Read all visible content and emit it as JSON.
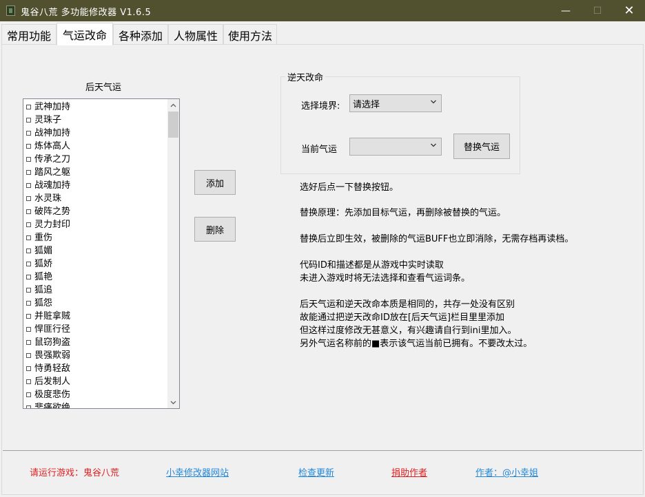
{
  "window": {
    "title": "鬼谷八荒 多功能修改器  V1.6.5",
    "minimize_icon": "—",
    "maximize_icon": "☐",
    "close_icon": "✕"
  },
  "tabs": [
    {
      "label": "常用功能"
    },
    {
      "label": "气运改命"
    },
    {
      "label": "各种添加"
    },
    {
      "label": "人物属性"
    },
    {
      "label": "使用方法"
    }
  ],
  "luck_list": {
    "title": "后天气运",
    "items": [
      "武神加持",
      "灵珠子",
      "战神加持",
      "炼体高人",
      "传承之刀",
      "踏风之躯",
      "战魂加持",
      "水灵珠",
      "破阵之势",
      "灵力封印",
      "重伤",
      "狐媚",
      "狐娇",
      "狐艳",
      "狐追",
      "狐怨",
      "并赃拿贼",
      "悍匪行径",
      "鼠窃狗盗",
      "畏强欺弱",
      "恃勇轻敌",
      "后发制人",
      "极度悲伤",
      "悲痛欲绝"
    ]
  },
  "buttons": {
    "add": "添加",
    "delete": "删除",
    "replace": "替换气运"
  },
  "fate_group": {
    "title": "逆天改命",
    "realm_label": "选择境界:",
    "realm_value": "请选择",
    "current_label": "当前气运",
    "current_value": ""
  },
  "info": [
    "选好后点一下替换按钮。",
    "替换原理：先添加目标气运，再删除被替换的气运。",
    "替换后立即生效，被删除的气运BUFF也立即消除，无需存档再读档。",
    "代码ID和描述都是从游戏中实时读取",
    "未进入游戏时将无法选择和查看气运词条。",
    "后天气运和逆天改命本质是相同的，共存一处没有区别",
    "故能通过把逆天改命ID放在[后天气运]栏目里里添加",
    "但这样过度修改无甚意义，有兴趣请自行到ini里加入。",
    "另外气运名称前的■表示该气运当前已拥有。不要改太过。"
  ],
  "footer": {
    "status": "请运行游戏：鬼谷八荒",
    "website": "小幸修改器网站",
    "update": "检查更新",
    "donate": "捐助作者",
    "author": "作者：@小幸姐"
  },
  "colors": {
    "titlebar": "#515130",
    "link_blue": "#2288dd",
    "alert_red": "#e02020"
  }
}
